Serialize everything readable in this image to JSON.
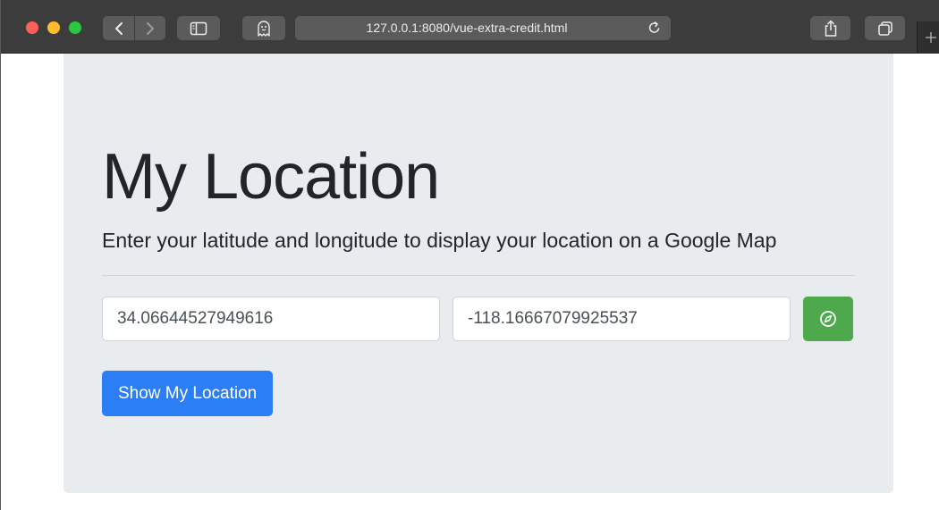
{
  "browser": {
    "url": "127.0.0.1:8080/vue-extra-credit.html",
    "icons": {
      "back": "chevron-left-icon",
      "forward": "chevron-right-icon",
      "sidebar": "sidebar-icon",
      "extension": "ghost-icon",
      "reload": "reload-icon",
      "share": "share-icon",
      "tabs": "tab-overview-icon",
      "new_tab": "plus-icon"
    },
    "traffic_colors": {
      "close": "#fe5f57",
      "minimize": "#febc2e",
      "zoom": "#28c840"
    }
  },
  "page": {
    "title": "My Location",
    "lead": "Enter your latitude and longitude to display your location on a Google Map",
    "latitude": {
      "value": "34.06644527949616"
    },
    "longitude": {
      "value": "-118.16667079925537"
    },
    "locate_button": {
      "icon": "compass-icon",
      "color": "#4ea84c"
    },
    "submit_button": {
      "label": "Show My Location",
      "color": "#2c7ef5"
    },
    "jumbotron_color": "#e9ecef"
  }
}
